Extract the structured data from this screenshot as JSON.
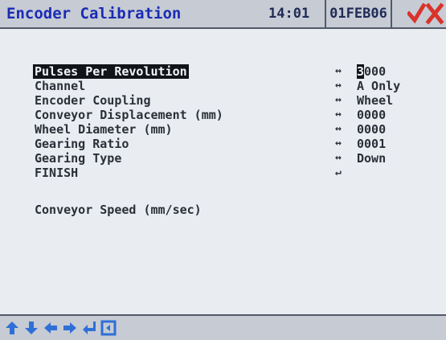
{
  "header": {
    "title": "Encoder Calibration",
    "time": "14:01",
    "date": "01FEB06",
    "status_icons": [
      "check-icon",
      "x-icon"
    ],
    "colors": {
      "title": "#1b2bb4",
      "check": "#d9332b",
      "x": "#d9332b"
    }
  },
  "params": [
    {
      "label": "Pulses Per Revolution",
      "value_cursor": "3",
      "value_rest": "000",
      "selected": true
    },
    {
      "label": "Channel",
      "value": "A Only"
    },
    {
      "label": "Encoder Coupling",
      "value": "Wheel"
    },
    {
      "label": "Conveyor Displacement (mm)",
      "value": "0000"
    },
    {
      "label": "Wheel Diameter (mm)",
      "value": "0000"
    },
    {
      "label": "Gearing Ratio",
      "value": "0001"
    },
    {
      "label": "Gearing Type",
      "value": "Down"
    },
    {
      "label": "FINISH",
      "icon": "enter-icon"
    }
  ],
  "readout": {
    "label": "Conveyor Speed (mm/sec)"
  },
  "footer": {
    "buttons": [
      "arrow-up-icon",
      "arrow-down-icon",
      "arrow-left-icon",
      "arrow-right-icon",
      "enter-icon",
      "exit-icon"
    ],
    "color": "#2f6fd6"
  }
}
